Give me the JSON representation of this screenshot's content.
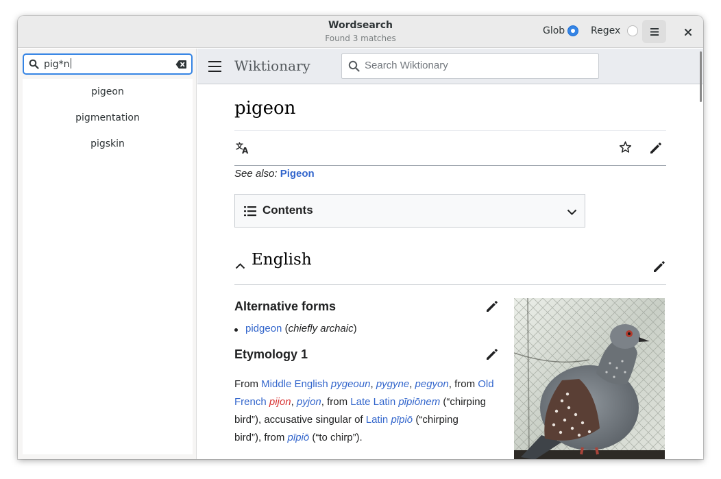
{
  "window": {
    "title": "Wordsearch",
    "subtitle": "Found 3 matches"
  },
  "header": {
    "glob_label": "Glob",
    "regex_label": "Regex",
    "glob_selected": true,
    "regex_selected": false,
    "menu_icon": "hamburger-menu-icon",
    "close_icon": "close-icon"
  },
  "sidebar": {
    "search_value": "pig*n",
    "results": [
      "pigeon",
      "pigmentation",
      "pigskin"
    ]
  },
  "wiki": {
    "site_name": "Wiktionary",
    "search_placeholder": "Search Wiktionary",
    "page_title": "pigeon",
    "see_also_prefix": "See also:",
    "see_also_link": "Pigeon",
    "toc_label": "Contents",
    "section_english": "English",
    "alt_forms_heading": "Alternative forms",
    "alt_forms": {
      "word": "pidgeon",
      "open_paren": "(",
      "note": "chiefly archaic",
      "close_paren": ")"
    },
    "etymology_heading": "Etymology 1",
    "etymology": {
      "t1": "From ",
      "middle_english": "Middle English",
      "sp1": " ",
      "pygeoun": "pygeoun",
      "c1": ", ",
      "pygyne": "pygyne",
      "c2": ", ",
      "pegyon": "pegyon",
      "t2": ", from ",
      "old": "Old",
      "french": "French",
      "sp2": " ",
      "pijon": "pijon",
      "c3": ", ",
      "pyjon": "pyjon",
      "t3": ", from ",
      "late_latin": "Late Latin",
      "sp3": " ",
      "pipionem": "pīpiōnem",
      "t4": " (“chirping",
      "t5": "bird”), accusative singular of ",
      "latin": "Latin",
      "sp4": " ",
      "pipio": "pīpiō",
      "t6": " (“chirping",
      "t7": "bird”), from ",
      "pipio2": "pīpiō",
      "t8": " (“to chirp”)."
    },
    "colors": {
      "link": "#3366cc",
      "redlink": "#d73333",
      "accent": "#3584e4"
    }
  }
}
